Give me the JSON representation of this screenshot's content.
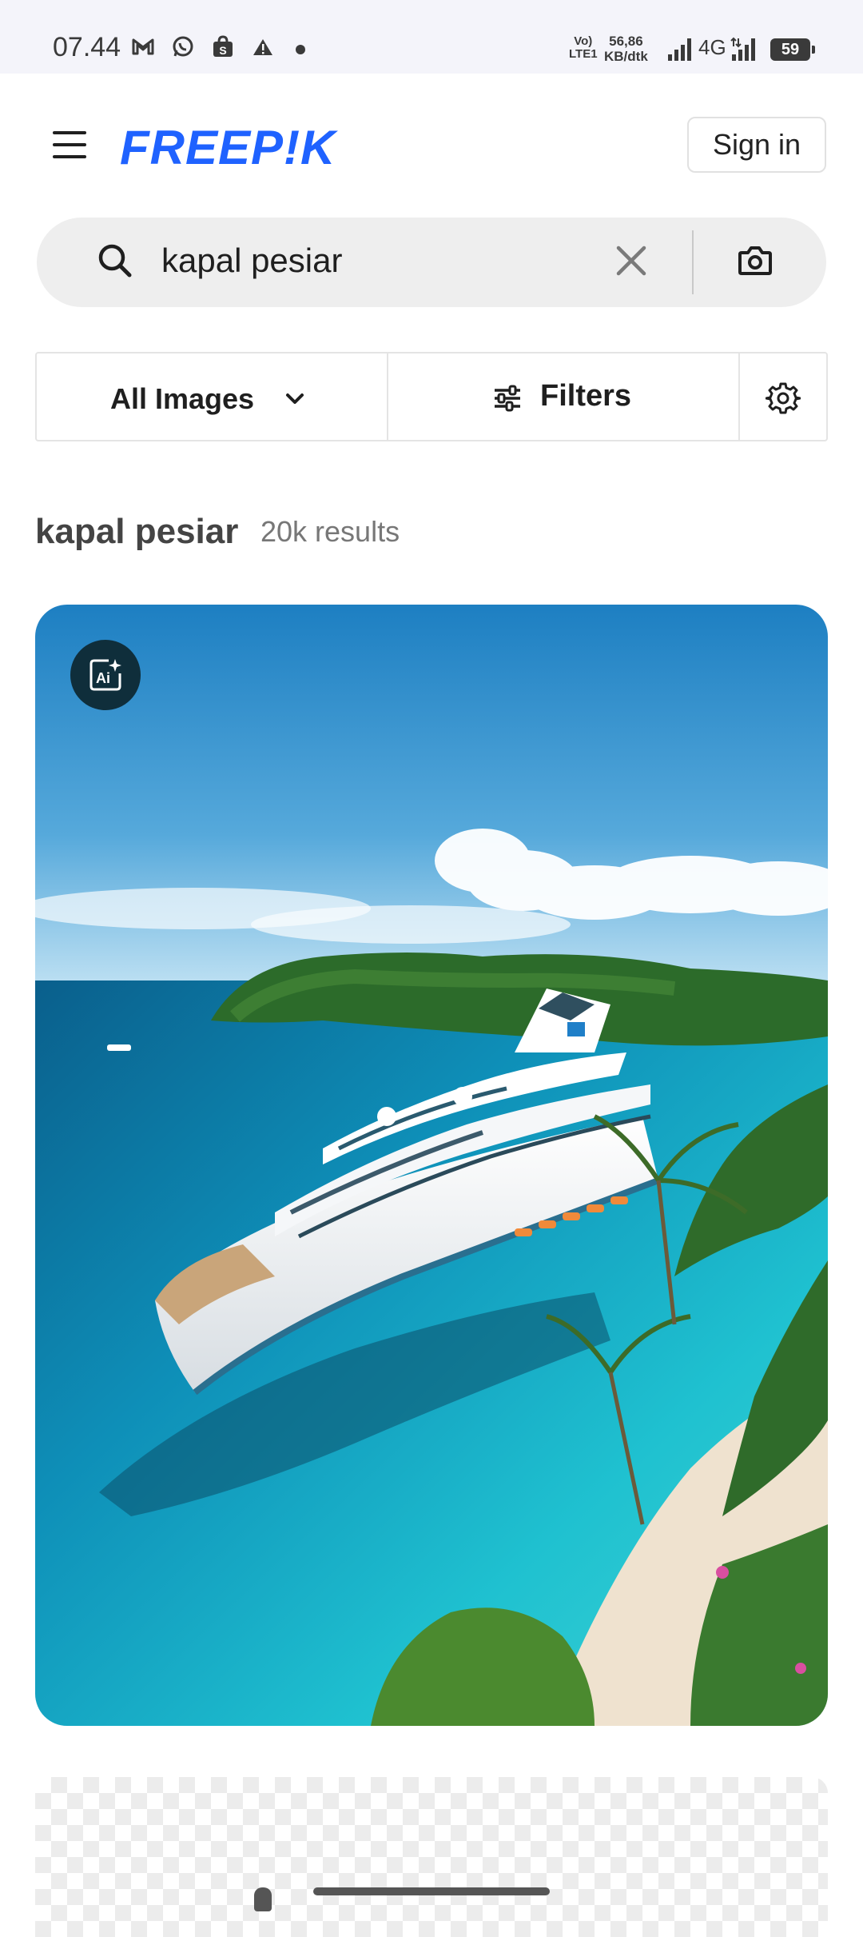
{
  "status_bar": {
    "time": "07.44",
    "volte": "Vo)",
    "lte": "LTE1",
    "speed_value": "56,86",
    "speed_unit": "KB/dtk",
    "network": "4G",
    "battery": "59"
  },
  "header": {
    "logo": "FREEP!K",
    "sign_in": "Sign in"
  },
  "search": {
    "query": "kapal pesiar"
  },
  "filters": {
    "type_select": "All Images",
    "filters_label": "Filters"
  },
  "results": {
    "query": "kapal pesiar",
    "count": "20k results"
  },
  "colors": {
    "brand": "#1f62ff",
    "badge": "#0f2e3b"
  },
  "icons": [
    "menu-icon",
    "search-icon",
    "close-icon",
    "camera-icon",
    "chevron-down-icon",
    "sliders-icon",
    "gear-icon",
    "ai-generated-icon"
  ]
}
